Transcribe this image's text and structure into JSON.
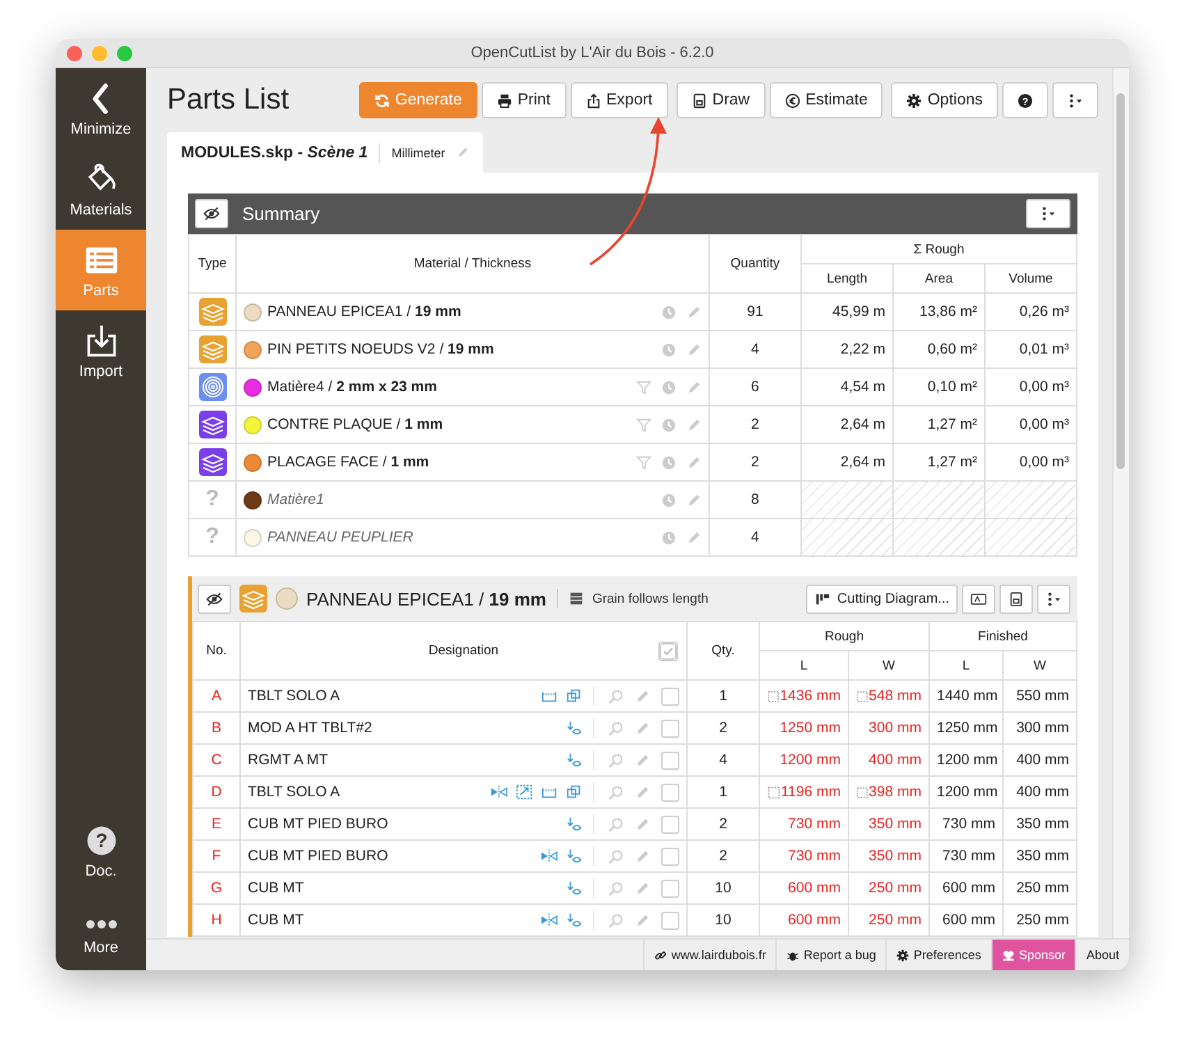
{
  "window": {
    "title": "OpenCutList by L'Air du Bois - 6.2.0"
  },
  "sidebar": {
    "top": [
      {
        "label": "Minimize",
        "kind": "minimize",
        "selected": false
      },
      {
        "label": "Materials",
        "kind": "materials",
        "selected": false
      },
      {
        "label": "Parts",
        "kind": "parts",
        "selected": true
      },
      {
        "label": "Import",
        "kind": "import",
        "selected": false
      }
    ],
    "bottom": [
      {
        "label": "Doc.",
        "kind": "doc",
        "glyph": "?",
        "selected": false
      },
      {
        "label": "More",
        "kind": "more",
        "selected": false
      }
    ]
  },
  "header": {
    "title": "Parts List",
    "button_groups": [
      [
        {
          "label": "Generate",
          "kind": "generate",
          "primary": true
        },
        {
          "label": "Print",
          "kind": "print",
          "primary": false
        },
        {
          "label": "Export",
          "kind": "export",
          "primary": false
        }
      ],
      [
        {
          "label": "Draw",
          "kind": "draw",
          "primary": false
        },
        {
          "label": "Estimate",
          "kind": "estimate",
          "primary": false
        }
      ],
      [
        {
          "label": "Options",
          "kind": "options",
          "primary": false
        },
        {
          "kind": "help",
          "glyph": "?",
          "primary": false
        },
        {
          "kind": "menu",
          "primary": false
        }
      ]
    ]
  },
  "tab": {
    "title": "MODULES.skp - *Scène 1*",
    "unit": "Millimeter"
  },
  "summary": {
    "title": "Summary",
    "columns": {
      "type": "Type",
      "material": "Material / Thickness",
      "quantity": "Quantity",
      "rough": "Σ Rough",
      "length": "Length",
      "area": "Area",
      "volume": "Volume"
    },
    "rows": [
      {
        "kind": "sheet",
        "color": "#eadbc2",
        "name": "PANNEAU EPICEA1 / **19 mm**",
        "filter": false,
        "quantity": "91",
        "length": "45,99 m",
        "area": "13,86 m²",
        "volume": "0,26 m³"
      },
      {
        "kind": "sheet",
        "color": "#f2a55a",
        "name": "PIN PETITS NOEUDS V2 / **19 mm**",
        "filter": false,
        "quantity": "4",
        "length": "2,22 m",
        "area": "0,60 m²",
        "volume": "0,01 m³"
      },
      {
        "kind": "edge",
        "color": "#e82ee0",
        "name": "Matière4 / **2 mm x 23 mm**",
        "filter": true,
        "quantity": "6",
        "length": "4,54 m",
        "area": "0,10 m²",
        "volume": "0,00 m³"
      },
      {
        "kind": "veneer",
        "color": "#f6f43a",
        "name": "CONTRE PLAQUE / **1 mm**",
        "filter": true,
        "quantity": "2",
        "length": "2,64 m",
        "area": "1,27 m²",
        "volume": "0,00 m³"
      },
      {
        "kind": "veneer",
        "color": "#ee8a36",
        "name": "PLACAGE FACE / **1 mm**",
        "filter": true,
        "quantity": "2",
        "length": "2,64 m",
        "area": "1,27 m²",
        "volume": "0,00 m³"
      },
      {
        "kind": "unknown",
        "type_glyph": "?",
        "color": "#6e3a16",
        "name": "Matière1",
        "filter": false,
        "quantity": "8"
      },
      {
        "kind": "unknown",
        "type_glyph": "?",
        "color": "#fbf7e4",
        "name": "PANNEAU PEUPLIER",
        "filter": false,
        "quantity": "4"
      }
    ]
  },
  "group": {
    "kind": "sheet",
    "color": "#eadbc2",
    "name": "PANNEAU EPICEA1 / **19 mm**",
    "grain": "Grain follows length",
    "diagram_button": "Cutting Diagram...",
    "select_all_checked": true,
    "columns": {
      "number": "No.",
      "designation": "Designation",
      "quantity": "Qty.",
      "rough": "Rough",
      "finished": "Finished",
      "rough_length": "L",
      "rough_width": "W",
      "finished_length": "L",
      "finished_width": "W"
    },
    "rows": [
      {
        "letter": "A",
        "designation": "TBLT SOLO A",
        "icons": [
          {
            "kind": "edge"
          },
          {
            "kind": "copies"
          }
        ],
        "checked": false,
        "quantity": "1",
        "rough": [
          {
            "value": "1436 mm",
            "outlined": true
          },
          {
            "value": "548 mm",
            "outlined": true
          }
        ],
        "finished": [
          "1440 mm",
          "550 mm"
        ]
      },
      {
        "letter": "B",
        "designation": "MOD A HT TBLT#2",
        "icons": [
          {
            "kind": "grain"
          }
        ],
        "checked": false,
        "quantity": "2",
        "rough": [
          {
            "value": "1250 mm",
            "outlined": false
          },
          {
            "value": "300 mm",
            "outlined": false
          }
        ],
        "finished": [
          "1250 mm",
          "300 mm"
        ]
      },
      {
        "letter": "C",
        "designation": "RGMT A MT",
        "icons": [
          {
            "kind": "grain"
          }
        ],
        "checked": false,
        "quantity": "4",
        "rough": [
          {
            "value": "1200 mm",
            "outlined": false
          },
          {
            "value": "400 mm",
            "outlined": false
          }
        ],
        "finished": [
          "1200 mm",
          "400 mm"
        ]
      },
      {
        "letter": "D",
        "designation": "TBLT SOLO A",
        "icons": [
          {
            "kind": "mirror"
          },
          {
            "kind": "resize"
          },
          {
            "kind": "edge"
          },
          {
            "kind": "copies"
          }
        ],
        "checked": false,
        "quantity": "1",
        "rough": [
          {
            "value": "1196 mm",
            "outlined": true
          },
          {
            "value": "398 mm",
            "outlined": true
          }
        ],
        "finished": [
          "1200 mm",
          "400 mm"
        ]
      },
      {
        "letter": "E",
        "designation": "CUB MT PIED BURO",
        "icons": [
          {
            "kind": "grain"
          }
        ],
        "checked": false,
        "quantity": "2",
        "rough": [
          {
            "value": "730 mm",
            "outlined": false
          },
          {
            "value": "350 mm",
            "outlined": false
          }
        ],
        "finished": [
          "730 mm",
          "350 mm"
        ]
      },
      {
        "letter": "F",
        "designation": "CUB MT PIED BURO",
        "icons": [
          {
            "kind": "mirror"
          },
          {
            "kind": "grain"
          }
        ],
        "checked": false,
        "quantity": "2",
        "rough": [
          {
            "value": "730 mm",
            "outlined": false
          },
          {
            "value": "350 mm",
            "outlined": false
          }
        ],
        "finished": [
          "730 mm",
          "350 mm"
        ]
      },
      {
        "letter": "G",
        "designation": "CUB MT",
        "icons": [
          {
            "kind": "grain"
          }
        ],
        "checked": false,
        "quantity": "10",
        "rough": [
          {
            "value": "600 mm",
            "outlined": false
          },
          {
            "value": "250 mm",
            "outlined": false
          }
        ],
        "finished": [
          "600 mm",
          "250 mm"
        ]
      },
      {
        "letter": "H",
        "designation": "CUB MT",
        "icons": [
          {
            "kind": "mirror"
          },
          {
            "kind": "grain"
          }
        ],
        "checked": false,
        "quantity": "10",
        "rough": [
          {
            "value": "600 mm",
            "outlined": false
          },
          {
            "value": "250 mm",
            "outlined": false
          }
        ],
        "finished": [
          "600 mm",
          "250 mm"
        ]
      }
    ]
  },
  "footer": [
    {
      "label": "www.lairdubois.fr",
      "kind": "link",
      "highlight": false
    },
    {
      "label": "Report a bug",
      "kind": "bug",
      "highlight": false
    },
    {
      "label": "Preferences",
      "kind": "preferences",
      "highlight": false
    },
    {
      "label": "Sponsor",
      "kind": "sponsor",
      "highlight": true
    },
    {
      "label": "About",
      "kind": "about",
      "highlight": false
    }
  ]
}
